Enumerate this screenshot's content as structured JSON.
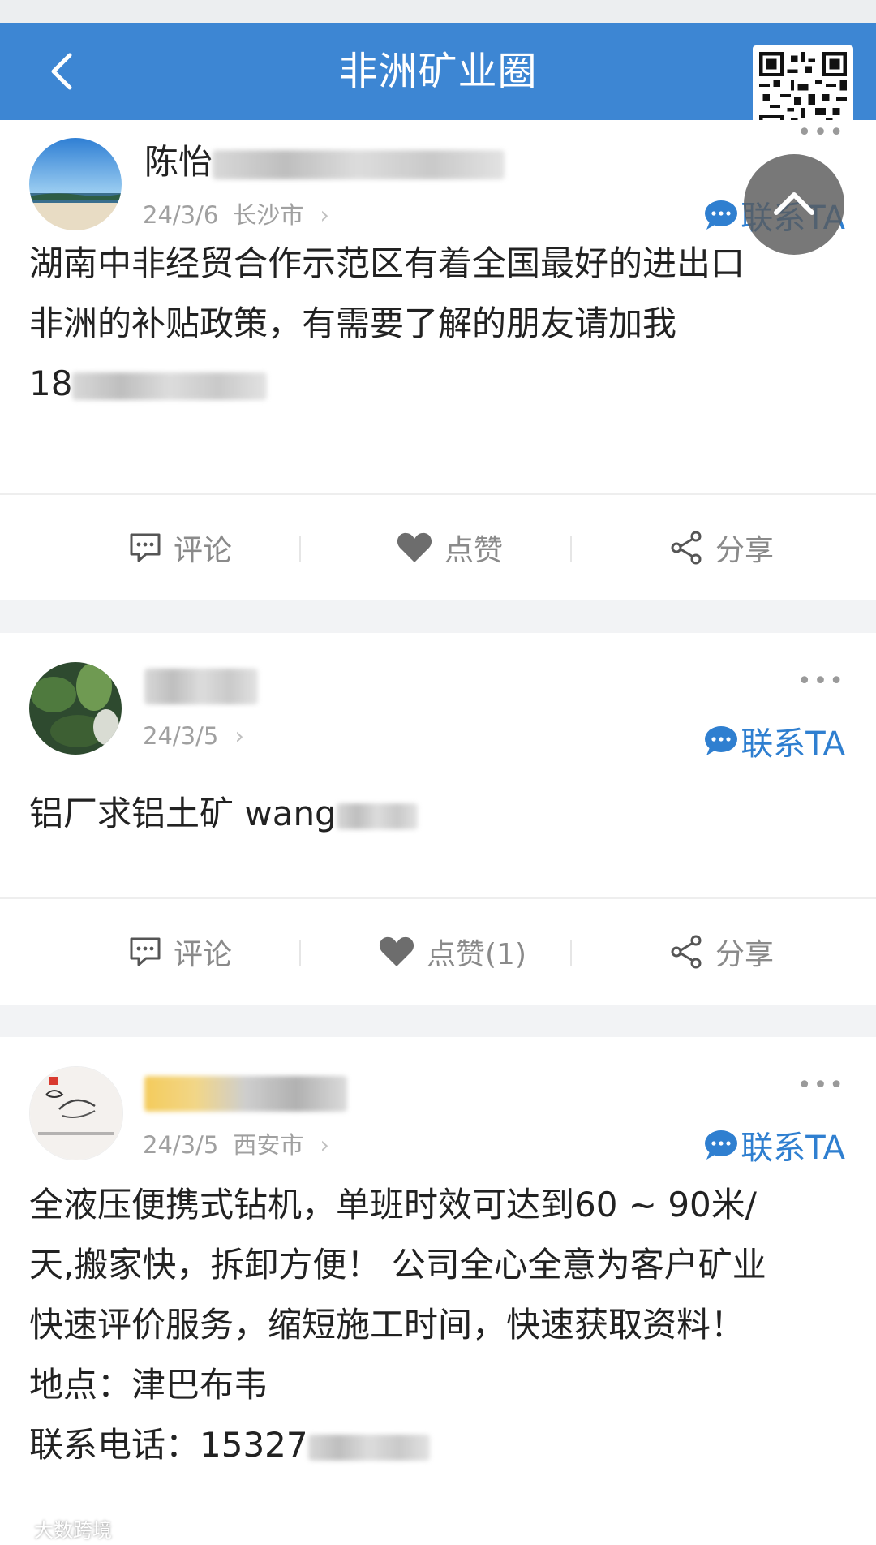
{
  "header": {
    "title": "非洲矿业圈",
    "back_icon": "chevron-left-icon",
    "qr_icon": "qr-code-icon"
  },
  "scroll_top_icon": "chevron-up-icon",
  "contact_label": "联系TA",
  "posts": [
    {
      "name_visible": "陈怡",
      "date": "24/3/6",
      "city": "长沙市",
      "text_lines": [
        "湖南中非经贸合作示范区有着全国最好的进出口",
        "非洲的补贴政策，有需要了解的朋友请加我",
        "18"
      ],
      "actions": {
        "comment": "评论",
        "like": "点赞",
        "share": "分享"
      }
    },
    {
      "name_visible": "",
      "date": "24/3/5",
      "city": "",
      "text_lines": [
        "铝厂求铝土矿 wang"
      ],
      "actions": {
        "comment": "评论",
        "like": "点赞(1)",
        "share": "分享"
      }
    },
    {
      "name_visible": "",
      "date": "24/3/5",
      "city": "西安市",
      "text_lines": [
        "全液压便携式钻机，单班时效可达到60 ~ 90米/",
        "天,搬家快，拆卸方便！ 公司全心全意为客户矿业",
        "快速评价服务，缩短施工时间，快速获取资料！",
        "地点：津巴布韦",
        "联系电话：15327"
      ]
    }
  ],
  "watermark": "大数跨境",
  "colors": {
    "header_bg": "#3d86d3",
    "contact": "#2f7fd0",
    "bg": "#f2f3f5"
  }
}
